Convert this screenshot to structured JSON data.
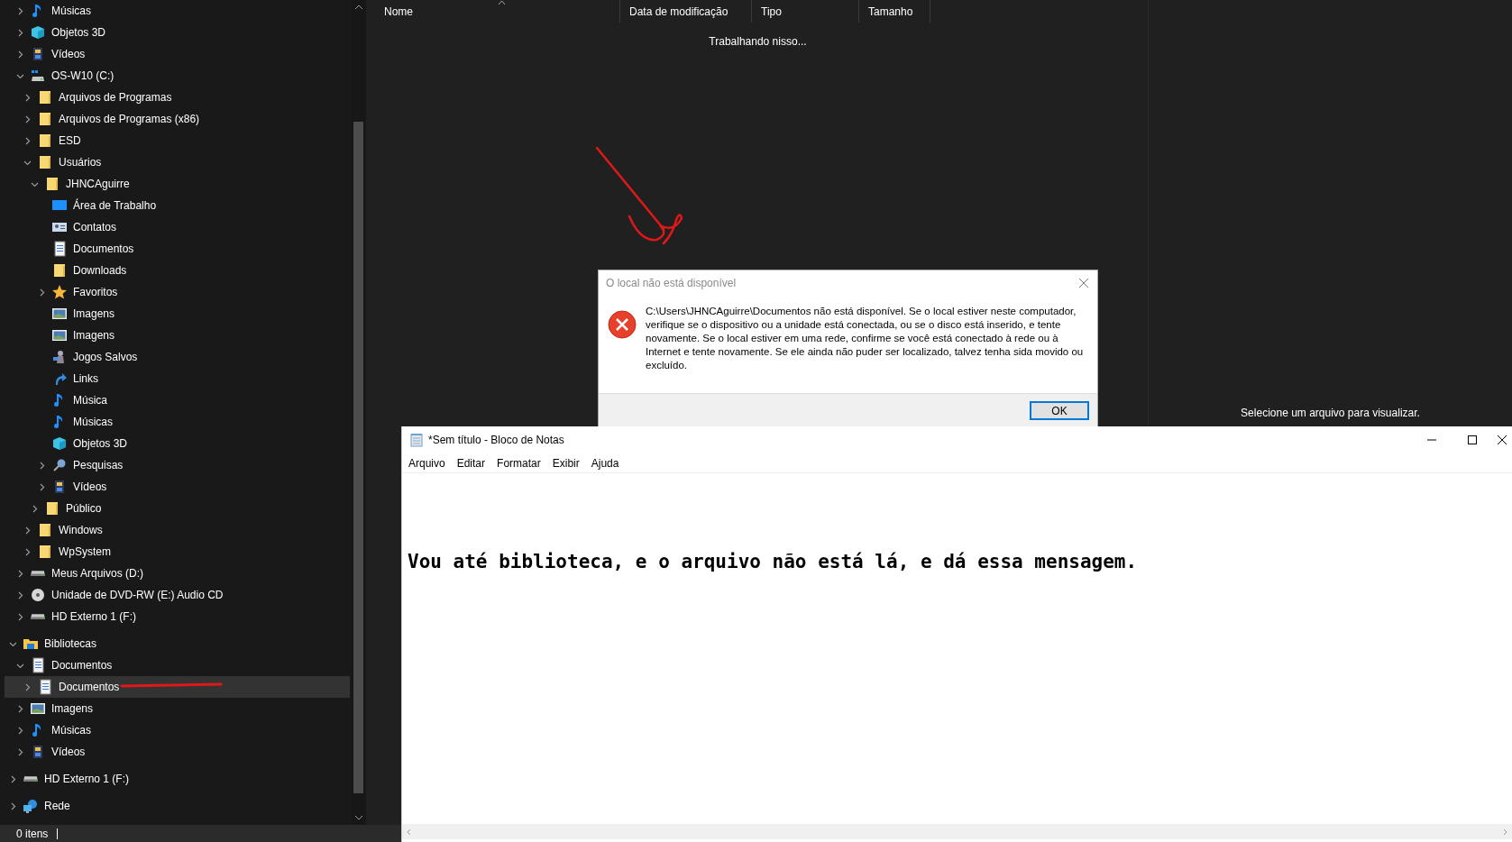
{
  "explorer": {
    "nav_tree": {
      "partial_children": [
        {
          "label": "Músicas",
          "kind": "music",
          "expanded": false,
          "selected": false
        },
        {
          "label": "Objetos 3D",
          "kind": "cube",
          "expanded": false,
          "selected": false
        },
        {
          "label": "Vídeos",
          "kind": "video",
          "expanded": false,
          "selected": false
        },
        {
          "label": "OS-W10 (C:)",
          "kind": "system-drive",
          "expanded": true,
          "selected": false,
          "children": [
            {
              "label": "Arquivos de Programas",
              "kind": "folder",
              "expanded": false,
              "selected": false
            },
            {
              "label": "Arquivos de Programas (x86)",
              "kind": "folder",
              "expanded": false,
              "selected": false
            },
            {
              "label": "ESD",
              "kind": "folder",
              "expanded": false,
              "selected": false
            },
            {
              "label": "Usuários",
              "kind": "folder",
              "expanded": true,
              "selected": false,
              "children": [
                {
                  "label": "JHNCAguirre",
                  "kind": "folder",
                  "expanded": true,
                  "selected": false,
                  "children": [
                    {
                      "label": "Área de Trabalho",
                      "kind": "desktop",
                      "selected": false
                    },
                    {
                      "label": "Contatos",
                      "kind": "contacts",
                      "selected": false
                    },
                    {
                      "label": "Documentos",
                      "kind": "document",
                      "selected": false
                    },
                    {
                      "label": "Downloads",
                      "kind": "folder",
                      "selected": false
                    },
                    {
                      "label": "Favoritos",
                      "kind": "star",
                      "expanded": false,
                      "selected": false
                    },
                    {
                      "label": "Imagens",
                      "kind": "image",
                      "selected": false
                    },
                    {
                      "label": "Imagens",
                      "kind": "image",
                      "selected": false
                    },
                    {
                      "label": "Jogos Salvos",
                      "kind": "games",
                      "selected": false
                    },
                    {
                      "label": "Links",
                      "kind": "link",
                      "selected": false
                    },
                    {
                      "label": "Música",
                      "kind": "music",
                      "selected": false
                    },
                    {
                      "label": "Músicas",
                      "kind": "music",
                      "selected": false
                    },
                    {
                      "label": "Objetos 3D",
                      "kind": "cube",
                      "selected": false
                    },
                    {
                      "label": "Pesquisas",
                      "kind": "search",
                      "expanded": false,
                      "selected": false
                    },
                    {
                      "label": "Vídeos",
                      "kind": "video",
                      "expanded": false,
                      "selected": false
                    }
                  ]
                },
                {
                  "label": "Público",
                  "kind": "folder",
                  "expanded": false,
                  "selected": false
                }
              ]
            },
            {
              "label": "Windows",
              "kind": "folder",
              "expanded": false,
              "selected": false
            },
            {
              "label": "WpSystem",
              "kind": "folder",
              "expanded": false,
              "selected": false
            }
          ]
        },
        {
          "label": "Meus Arquivos (D:)",
          "kind": "drive",
          "expanded": false,
          "selected": false
        },
        {
          "label": "Unidade de DVD-RW (E:) Audio CD",
          "kind": "disc",
          "expanded": false,
          "selected": false
        },
        {
          "label": "HD Externo 1 (F:)",
          "kind": "drive",
          "expanded": false,
          "selected": false
        }
      ],
      "roots": [
        {
          "label": "Bibliotecas",
          "kind": "library",
          "expanded": true,
          "selected": false,
          "children": [
            {
              "label": "Documentos",
              "kind": "document",
              "expanded": true,
              "selected": false,
              "children": [
                {
                  "label": "Documentos",
                  "kind": "document",
                  "expanded": false,
                  "selected": true
                }
              ]
            },
            {
              "label": "Imagens",
              "kind": "image",
              "expanded": false,
              "selected": false
            },
            {
              "label": "Músicas",
              "kind": "music",
              "expanded": false,
              "selected": false
            },
            {
              "label": "Vídeos",
              "kind": "video",
              "expanded": false,
              "selected": false
            }
          ]
        },
        {
          "label": "HD Externo 1 (F:)",
          "kind": "drive",
          "expanded": false,
          "selected": false
        },
        {
          "label": "Rede",
          "kind": "network",
          "expanded": false,
          "selected": false
        }
      ]
    },
    "columns": [
      {
        "label": "Nome",
        "sorted": true
      },
      {
        "label": "Data de modificação",
        "sorted": false
      },
      {
        "label": "Tipo",
        "sorted": false
      },
      {
        "label": "Tamanho",
        "sorted": false
      }
    ],
    "list_message": "Trabalhando nisso...",
    "preview_message": "Selecione um arquivo para visualizar.",
    "status_bar": {
      "item_count": "0 itens"
    }
  },
  "dialog": {
    "title": "O local não está disponível",
    "message": "C:\\Users\\JHNCAguirre\\Documentos não está disponível. Se o local estiver neste computador, verifique se o dispositivo ou a unidade está conectada, ou se o disco está inserido, e tente novamente. Se o local estiver em uma rede, confirme se você está conectado à rede ou à Internet e tente novamente. Se ele ainda não puder ser localizado, talvez tenha sida movido ou excluído.",
    "buttons": [
      "OK"
    ]
  },
  "notepad": {
    "title": "*Sem título - Bloco de Notas",
    "menu": [
      "Arquivo",
      "Editar",
      "Formatar",
      "Exibir",
      "Ajuda"
    ],
    "content": "Vou até biblioteca, e o arquivo não está lá, e dá essa mensagem."
  }
}
